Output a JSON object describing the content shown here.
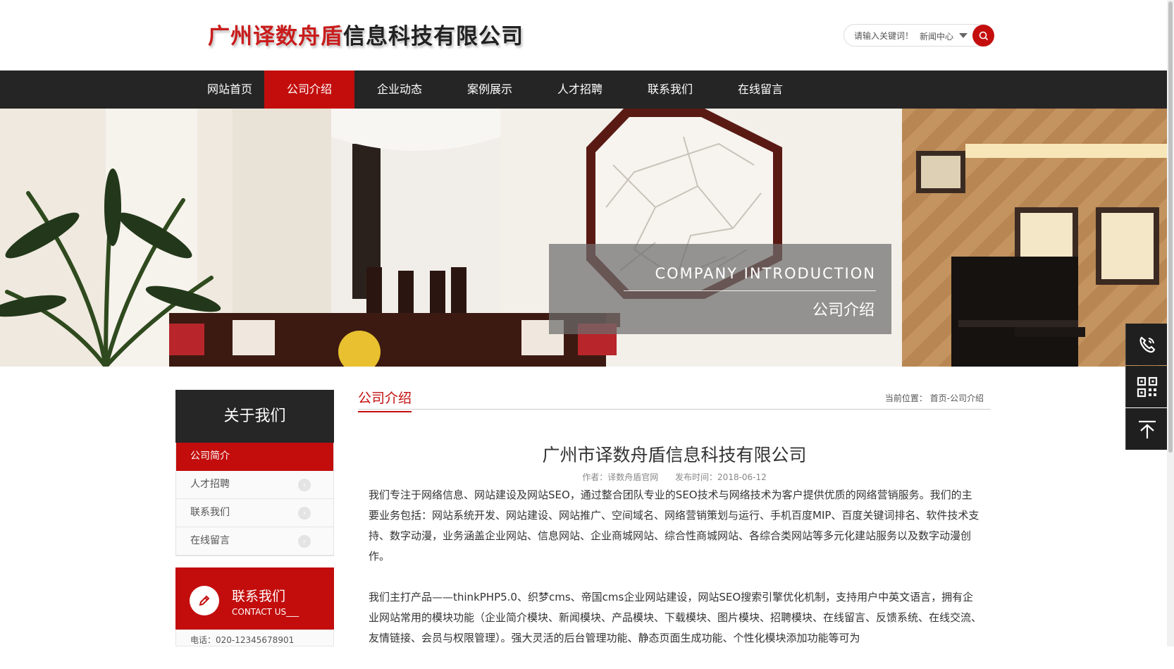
{
  "header": {
    "logo_red": "广州译数舟盾",
    "logo_dark": "信息科技有限公司",
    "search_placeholder": "请输入关键词！",
    "search_scope": "新闻中心"
  },
  "nav": {
    "items": [
      {
        "label": "网站首页"
      },
      {
        "label": "公司介绍",
        "active": true
      },
      {
        "label": "企业动态"
      },
      {
        "label": "案例展示"
      },
      {
        "label": "人才招聘"
      },
      {
        "label": "联系我们"
      },
      {
        "label": "在线留言"
      }
    ]
  },
  "banner": {
    "en": "COMPANY INTRODUCTION",
    "cn": "公司介绍"
  },
  "sidebar": {
    "title": "关于我们",
    "items": [
      {
        "label": "公司简介",
        "active": true
      },
      {
        "label": "人才招聘"
      },
      {
        "label": "联系我们"
      },
      {
        "label": "在线留言"
      }
    ],
    "contact_title": "联系我们",
    "contact_sub": "CONTACT US___",
    "contact_phone": "电话：020-12345678901"
  },
  "main": {
    "section_title": "公司介绍",
    "breadcrumb": "当前位置： 首页-公司介绍",
    "article_title": "广州市译数舟盾信息科技有限公司",
    "author": "作者：译数舟盾官网",
    "date": "发布时间：2018-06-12",
    "paragraphs": [
      "我们专注于网络信息、网站建设及网站SEO，通过整合团队专业的SEO技术与网络技术为客户提供优质的网络营销服务。我们的主要业务包括：网站系统开发、网站建设、网站推广、空间域名、网络营销策划与运行、手机百度MIP、百度关键词排名、软件技术支持、数字动漫，业务涵盖企业网站、信息网站、企业商城网站、综合性商城网站、各综合类网站等多元化建站服务以及数字动漫创作。",
      "我们主打产品——thinkPHP5.0、织梦cms、帝国cms企业网站建设，网站SEO搜索引擎优化机制，支持用户中英文语言，拥有企业网站常用的模块功能（企业简介模块、新闻模块、产品模块、下载模块、图片模块、招聘模块、在线留言、反馈系统、在线交流、友情链接、会员与权限管理）。强大灵活的后台管理功能、静态页面生成功能、个性化模块添加功能等可为"
    ]
  },
  "colors": {
    "accent": "#c30d0d",
    "nav_bg": "#252525"
  }
}
